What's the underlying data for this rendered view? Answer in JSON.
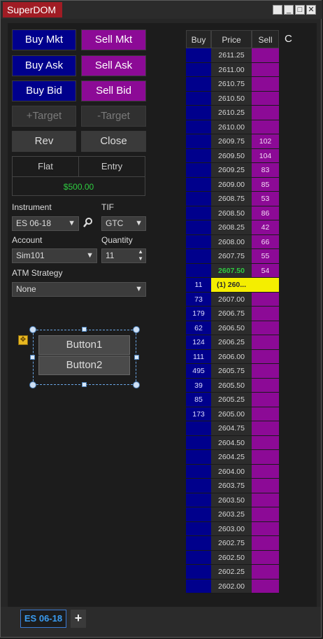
{
  "window": {
    "title": "SuperDOM"
  },
  "order_buttons": {
    "buy_mkt": "Buy Mkt",
    "sell_mkt": "Sell Mkt",
    "buy_ask": "Buy Ask",
    "sell_ask": "Sell Ask",
    "buy_bid": "Buy Bid",
    "sell_bid": "Sell Bid",
    "plus_target": "+Target",
    "minus_target": "-Target",
    "rev": "Rev",
    "close": "Close"
  },
  "position": {
    "flat_label": "Flat",
    "entry_label": "Entry",
    "pnl": "$500.00"
  },
  "form": {
    "instrument_label": "Instrument",
    "instrument_value": "ES 06-18",
    "tif_label": "TIF",
    "tif_value": "GTC",
    "account_label": "Account",
    "account_value": "Sim101",
    "quantity_label": "Quantity",
    "quantity_value": "11",
    "atm_label": "ATM Strategy",
    "atm_value": "None"
  },
  "designer_buttons": {
    "button1": "Button1",
    "button2": "Button2"
  },
  "dom": {
    "headers": {
      "buy": "Buy",
      "price": "Price",
      "sell": "Sell",
      "extra": "C"
    },
    "rows": [
      {
        "buy": "",
        "price": "2611.25",
        "sell": ""
      },
      {
        "buy": "",
        "price": "2611.00",
        "sell": ""
      },
      {
        "buy": "",
        "price": "2610.75",
        "sell": ""
      },
      {
        "buy": "",
        "price": "2610.50",
        "sell": ""
      },
      {
        "buy": "",
        "price": "2610.25",
        "sell": ""
      },
      {
        "buy": "",
        "price": "2610.00",
        "sell": ""
      },
      {
        "buy": "",
        "price": "2609.75",
        "sell": "102"
      },
      {
        "buy": "",
        "price": "2609.50",
        "sell": "104"
      },
      {
        "buy": "",
        "price": "2609.25",
        "sell": "83"
      },
      {
        "buy": "",
        "price": "2609.00",
        "sell": "85"
      },
      {
        "buy": "",
        "price": "2608.75",
        "sell": "53"
      },
      {
        "buy": "",
        "price": "2608.50",
        "sell": "86"
      },
      {
        "buy": "",
        "price": "2608.25",
        "sell": "42"
      },
      {
        "buy": "",
        "price": "2608.00",
        "sell": "66"
      },
      {
        "buy": "",
        "price": "2607.75",
        "sell": "55"
      },
      {
        "buy": "",
        "price": "2607.50",
        "sell": "54",
        "state": "last"
      },
      {
        "buy": "11",
        "price": "(1) 260...",
        "sell": "",
        "state": "cur"
      },
      {
        "buy": "73",
        "price": "2607.00",
        "sell": ""
      },
      {
        "buy": "179",
        "price": "2606.75",
        "sell": ""
      },
      {
        "buy": "62",
        "price": "2606.50",
        "sell": ""
      },
      {
        "buy": "124",
        "price": "2606.25",
        "sell": ""
      },
      {
        "buy": "111",
        "price": "2606.00",
        "sell": ""
      },
      {
        "buy": "495",
        "price": "2605.75",
        "sell": ""
      },
      {
        "buy": "39",
        "price": "2605.50",
        "sell": ""
      },
      {
        "buy": "85",
        "price": "2605.25",
        "sell": ""
      },
      {
        "buy": "173",
        "price": "2605.00",
        "sell": ""
      },
      {
        "buy": "",
        "price": "2604.75",
        "sell": ""
      },
      {
        "buy": "",
        "price": "2604.50",
        "sell": ""
      },
      {
        "buy": "",
        "price": "2604.25",
        "sell": ""
      },
      {
        "buy": "",
        "price": "2604.00",
        "sell": ""
      },
      {
        "buy": "",
        "price": "2603.75",
        "sell": ""
      },
      {
        "buy": "",
        "price": "2603.50",
        "sell": ""
      },
      {
        "buy": "",
        "price": "2603.25",
        "sell": ""
      },
      {
        "buy": "",
        "price": "2603.00",
        "sell": ""
      },
      {
        "buy": "",
        "price": "2602.75",
        "sell": ""
      },
      {
        "buy": "",
        "price": "2602.50",
        "sell": ""
      },
      {
        "buy": "",
        "price": "2602.25",
        "sell": ""
      },
      {
        "buy": "",
        "price": "2602.00",
        "sell": ""
      }
    ]
  },
  "tabs": {
    "active": "ES 06-18",
    "add": "+"
  },
  "colors": {
    "buy": "#00008c",
    "sell": "#8c0a96",
    "highlight": "#f4ee00",
    "pnl": "#2ecc40",
    "title": "#a01c24"
  }
}
